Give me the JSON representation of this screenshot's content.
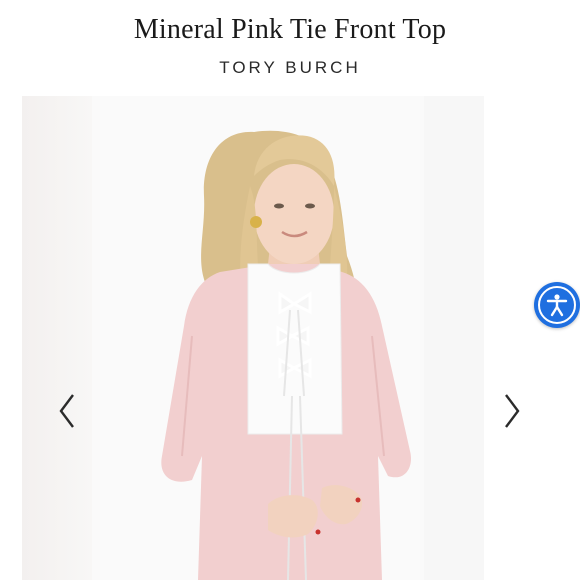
{
  "product": {
    "title": "Mineral Pink Tie Front Top",
    "brand": "TORY BURCH"
  },
  "gallery": {
    "image_alt": "model-wearing-pink-tie-front-top",
    "prev_icon": "chevron-left-icon",
    "next_icon": "chevron-right-icon"
  },
  "accessibility": {
    "icon": "accessibility-icon",
    "accent_color": "#1f6fe0"
  },
  "colors": {
    "top_pink": "#f2cfcf",
    "bib_white": "#fbfbfb"
  }
}
